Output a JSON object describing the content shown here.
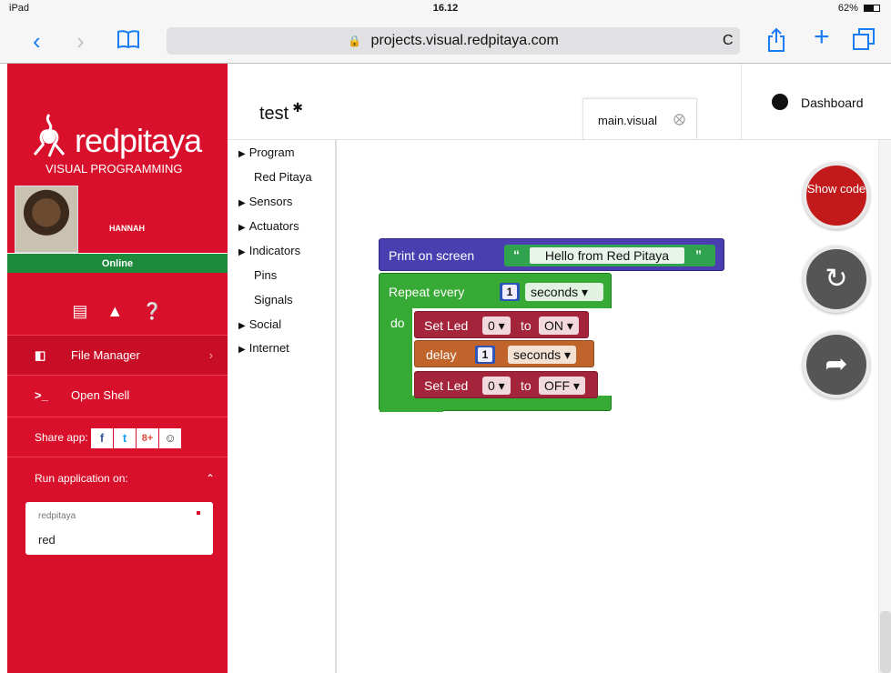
{
  "status_bar": {
    "device": "iPad",
    "wifi": "▾",
    "time": "16.12",
    "battery": "62%"
  },
  "browser": {
    "url": "projects.visual.redpitaya.com",
    "icons": {
      "back": "‹",
      "forward": "›",
      "bookmarks": "⎘",
      "reload": "C",
      "share": "⇪",
      "new_tab": "+",
      "tabs": "⧉"
    }
  },
  "sidebar": {
    "logo_word": "redpitaya",
    "logo_sub": "VISUAL PROGRAMMING",
    "user_name": "HANNAH",
    "status": "Online",
    "file_manager": "File Manager",
    "open_shell": "Open Shell",
    "share_label": "Share app:",
    "share_buttons": [
      "f",
      "t",
      "8+",
      "☺"
    ],
    "run_label": "Run application on:",
    "device_logo": "redpitaya",
    "device_name": "red"
  },
  "project": {
    "title": "test",
    "tab_name": "main.visual",
    "dashboard": "Dashboard"
  },
  "toolbox": {
    "items": [
      {
        "label": "Program",
        "expandable": true
      },
      {
        "label": "Red Pitaya",
        "expandable": false
      },
      {
        "label": "Sensors",
        "expandable": true
      },
      {
        "label": "Actuators",
        "expandable": true
      },
      {
        "label": "Indicators",
        "expandable": true
      },
      {
        "label": "Pins",
        "expandable": false
      },
      {
        "label": "Signals",
        "expandable": false
      },
      {
        "label": "Social",
        "expandable": true
      },
      {
        "label": "Internet",
        "expandable": true
      }
    ]
  },
  "blocks": {
    "print_label": "Print on screen",
    "print_value": "Hello from Red Pitaya",
    "open_quote": "“",
    "close_quote": "”",
    "repeat_label": "Repeat every",
    "repeat_num": "1",
    "repeat_unit": "seconds",
    "do_label": "do",
    "set_led_label": "Set Led",
    "to_label": "to",
    "led_on_index": "0",
    "led_on_state": "ON",
    "delay_label": "delay",
    "delay_num": "1",
    "delay_unit": "seconds",
    "led_off_index": "0",
    "led_off_state": "OFF"
  },
  "controls": {
    "show_code": "Show code"
  }
}
